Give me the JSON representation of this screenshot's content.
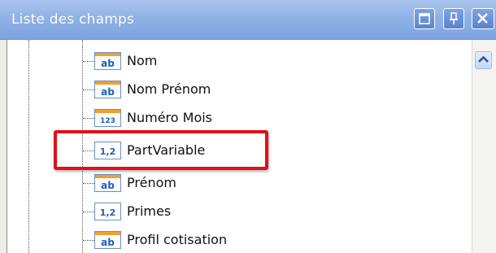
{
  "panel": {
    "title": "Liste des champs",
    "buttons": [
      {
        "name": "restore-button",
        "icon": "restore-icon"
      },
      {
        "name": "pin-button",
        "icon": "pin-icon"
      },
      {
        "name": "close-button",
        "icon": "close-icon"
      }
    ]
  },
  "fields": [
    {
      "label": "Nom",
      "type_icon": "text-field-icon",
      "badge": "ab"
    },
    {
      "label": "Nom Prénom",
      "type_icon": "text-field-icon",
      "badge": "ab"
    },
    {
      "label": "Numéro Mois",
      "type_icon": "integer-field-icon",
      "badge": "123"
    },
    {
      "label": "PartVariable",
      "type_icon": "decimal-field-icon",
      "badge": "1,2",
      "highlighted": true
    },
    {
      "label": "Prénom",
      "type_icon": "text-field-icon",
      "badge": "ab"
    },
    {
      "label": "Primes",
      "type_icon": "decimal-field-icon",
      "badge": "1,2"
    },
    {
      "label": "Profil cotisation",
      "type_icon": "text-field-icon",
      "badge": "ab"
    }
  ],
  "colors": {
    "titlebar": "#8fb2e6",
    "highlight": "#e0101a",
    "badge_blue": "#1e5fb8",
    "badge_orange": "#f0a030"
  }
}
